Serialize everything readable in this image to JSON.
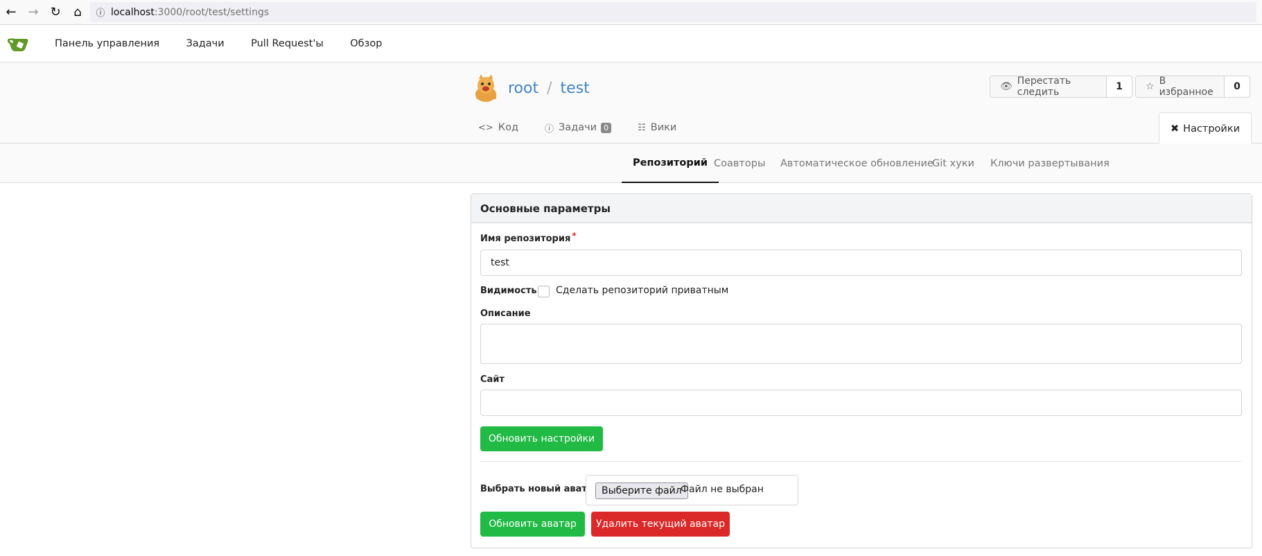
{
  "browser": {
    "url_host": "localhost",
    "url_path": ":3000/root/test/settings"
  },
  "nav": {
    "items": [
      "Панель управления",
      "Задачи",
      "Pull Request'ы",
      "Обзор"
    ]
  },
  "repo": {
    "owner": "root",
    "separator": "/",
    "name": "test",
    "watch_label": "Перестать следить",
    "watch_count": "1",
    "star_label": "В избранное",
    "star_count": "0",
    "tabs": {
      "code": "Код",
      "issues": "Задачи",
      "issues_count": "0",
      "wiki": "Вики",
      "settings": "Настройки"
    }
  },
  "settings_tabs": {
    "repository": "Репозиторий",
    "collaborators": "Соавторы",
    "mirror": "Автоматическое обновление",
    "git_hooks": "Git хуки",
    "deploy_keys": "Ключи развертывания"
  },
  "panel": {
    "title": "Основные параметры",
    "repo_name_label": "Имя репозитория",
    "required_mark": "*",
    "repo_name_value": "test",
    "visibility_label": "Видимость",
    "private_label": "Сделать репозиторий приватным",
    "private_checked": false,
    "description_label": "Описание",
    "description_value": "",
    "site_label": "Сайт",
    "site_value": "",
    "update_settings_btn": "Обновить настройки",
    "avatar_label": "Выбрать новый аватар",
    "choose_file_btn": "Выберите файл",
    "no_file_text": "Файл не выбран",
    "update_avatar_btn": "Обновить аватар",
    "delete_avatar_btn": "Удалить текущий аватар"
  },
  "colors": {
    "link": "#4183c4",
    "green": "#21ba45",
    "red": "#db2828"
  }
}
